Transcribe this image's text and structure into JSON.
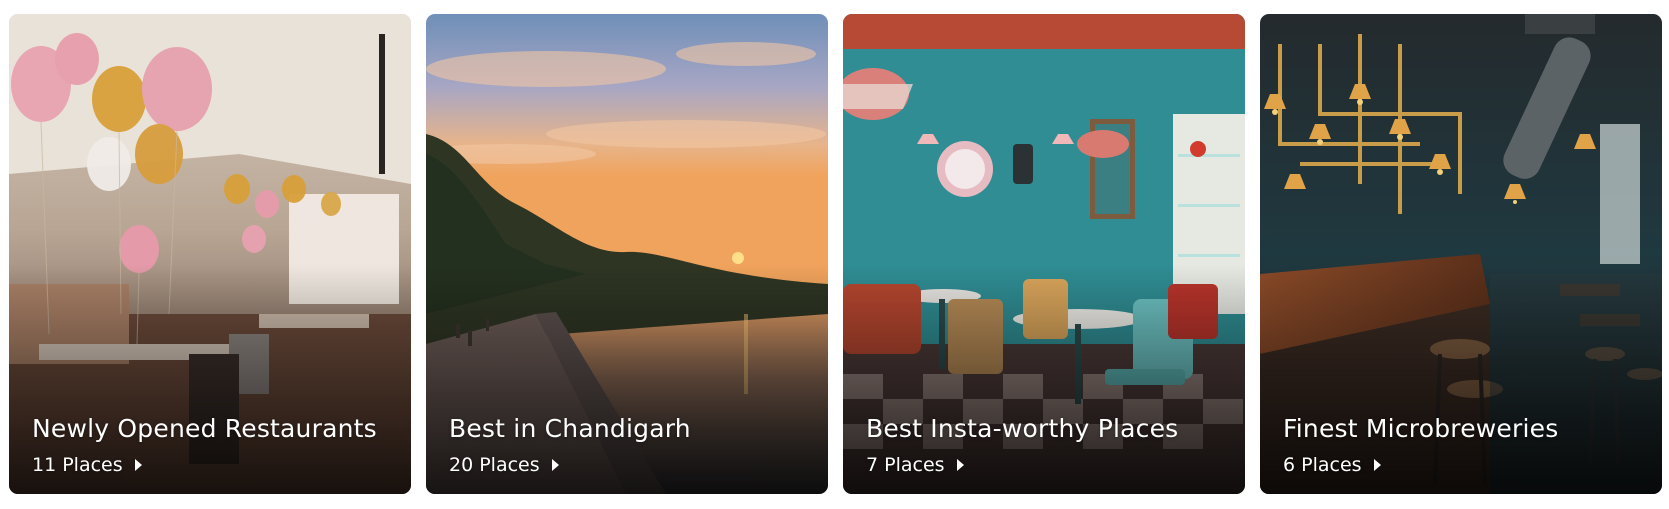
{
  "collections": [
    {
      "title": "Newly Opened Restaurants",
      "places": "11 Places",
      "icon": "chevron-right-icon",
      "image": "restaurant-interior-with-balloons"
    },
    {
      "title": "Best in Chandigarh",
      "places": "20 Places",
      "icon": "chevron-right-icon",
      "image": "sunset-over-lake"
    },
    {
      "title": "Best Insta-worthy Places",
      "places": "7 Places",
      "icon": "chevron-right-icon",
      "image": "retro-cafe-interior"
    },
    {
      "title": "Finest Microbreweries",
      "places": "6 Places",
      "icon": "chevron-right-icon",
      "image": "brewery-bar-interior"
    }
  ],
  "colors": {
    "caption_text": "#ffffff",
    "card_overlay": "#000000"
  }
}
